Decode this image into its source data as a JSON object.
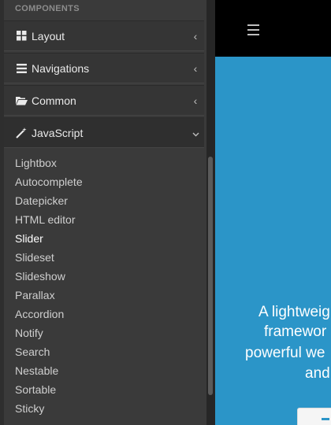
{
  "sidebar": {
    "section_header": "COMPONENTS",
    "nav": [
      {
        "label": "Layout",
        "icon": "grid-icon",
        "expanded": false
      },
      {
        "label": "Navigations",
        "icon": "list-icon",
        "expanded": false
      },
      {
        "label": "Common",
        "icon": "folder-open-icon",
        "expanded": false
      },
      {
        "label": "JavaScript",
        "icon": "magic-wand-icon",
        "expanded": true
      }
    ],
    "javascript_items": [
      "Lightbox",
      "Autocomplete",
      "Datepicker",
      "HTML editor",
      "Slider",
      "Slideset",
      "Slideshow",
      "Parallax",
      "Accordion",
      "Notify",
      "Search",
      "Nestable",
      "Sortable",
      "Sticky"
    ],
    "current_item": "Slider"
  },
  "main": {
    "hero_lines": [
      "A lightweig",
      "framewor",
      "powerful we",
      "and"
    ]
  },
  "colors": {
    "sidebar_bg": "#3a3a3a",
    "accent_blue": "#2b95c8",
    "topbar_bg": "#000000"
  }
}
